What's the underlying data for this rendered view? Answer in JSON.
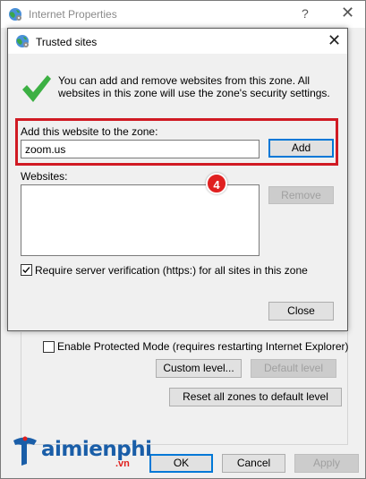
{
  "parent": {
    "title": "Internet Properties",
    "help_glyph": "?",
    "close_glyph": "✕",
    "protected_mode_label": "Enable Protected Mode (requires restarting Internet Explorer)",
    "protected_mode_checked": false,
    "custom_level_label": "Custom level...",
    "default_level_label": "Default level",
    "reset_all_label": "Reset all zones to default level",
    "ok_label": "OK",
    "cancel_label": "Cancel",
    "apply_label": "Apply"
  },
  "dialog": {
    "title": "Trusted sites",
    "close_glyph": "✕",
    "info_text": "You can add and remove websites from this zone. All websites in this zone will use the zone's security settings.",
    "add_label": "Add this website to the zone:",
    "url_value": "zoom.us",
    "add_button": "Add",
    "websites_label": "Websites:",
    "websites": [],
    "remove_button": "Remove",
    "require_label": "Require server verification (https:) for all sites in this zone",
    "require_checked": true,
    "close_button": "Close"
  },
  "annotation": {
    "step_number": "4",
    "highlight_color": "#d01a23"
  },
  "watermark": {
    "brand": "aimienphi",
    "suffix": ".vn"
  }
}
